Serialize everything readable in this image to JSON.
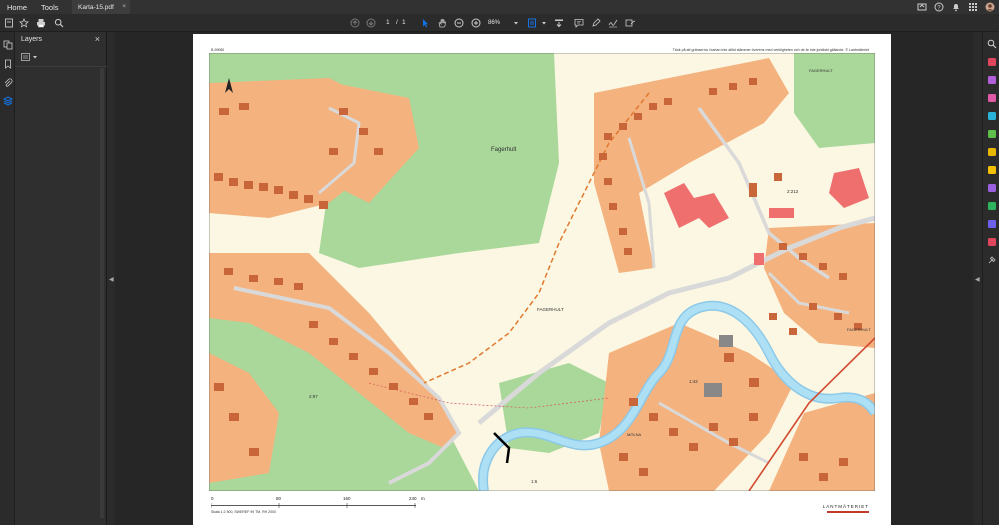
{
  "menubar": {
    "home": "Home",
    "tools": "Tools"
  },
  "tab": {
    "title": "Karta-15.pdf",
    "close": "×"
  },
  "toolbar": {
    "page_current": "1",
    "page_sep": "/",
    "page_total": "1",
    "zoom": "86%"
  },
  "panel": {
    "title": "Layers",
    "close": "×"
  },
  "map": {
    "note": "Tänk på att gränserna i kartan inte alltid stämmer överens med verkligheten och de är inte juridiskt gällande. © Lantmäteriet",
    "code": "B-99080",
    "labels": {
      "fagerhult_area": "Fagerhult",
      "fagerhult_center": "FAGERHULT",
      "fagerhult_ne": "FAGERHULT",
      "fagerhult_e": "FAGERHULT",
      "molna": "MÖLNA",
      "parcel_2212": "2:212",
      "parcel_297": "2:97",
      "parcel_142": "1:42",
      "parcel_16": "1:6"
    }
  },
  "scale": {
    "l0": "0",
    "l1": "80",
    "l2": "160",
    "l3": "240",
    "unit": "m",
    "text": "Skala 1:2 500, SWEREF 99 TM, RH 2000"
  },
  "brand": {
    "name": "LANTMÄTERIET"
  },
  "colors": {
    "accent": "#1473e6",
    "residential": "#f4b27f",
    "building": "#c8663a",
    "public_building": "#ef6f6f",
    "forest": "#a9d89a",
    "open_land": "#fbf7e3",
    "water": "#aee0f5",
    "road": "#d9d9d9"
  }
}
